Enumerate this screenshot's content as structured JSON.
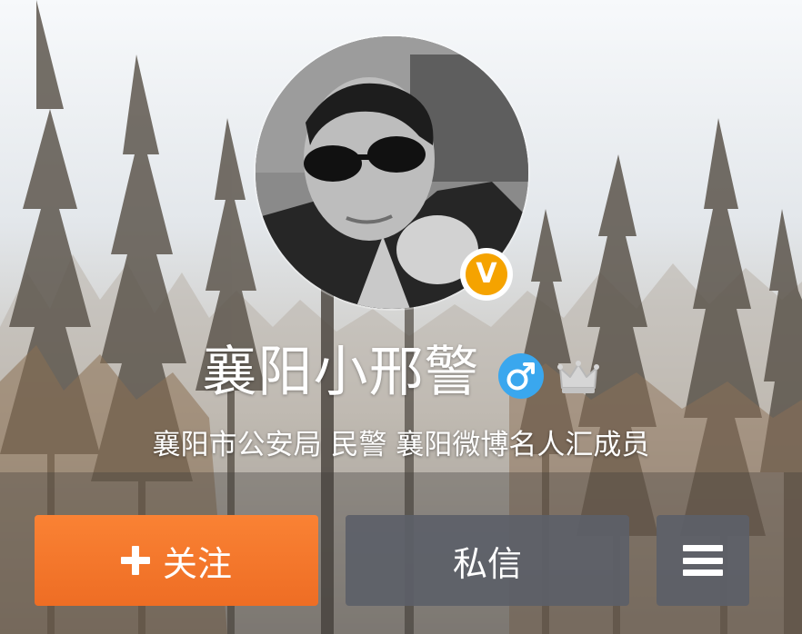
{
  "profile": {
    "name": "襄阳小邢警",
    "verified_badge_letter": "V",
    "gender": "male",
    "gender_icon": "male-symbol-icon",
    "member_icon": "crown-icon",
    "description": "襄阳市公安局 民警 襄阳微博名人汇成员"
  },
  "actions": {
    "follow_label": "关注",
    "follow_icon": "plus-icon",
    "message_label": "私信",
    "menu_icon": "hamburger-menu-icon"
  },
  "colors": {
    "follow_button": "#f0742a",
    "secondary_button": "#5c6068",
    "verified_badge": "#f5a300",
    "gender_icon": "#3aa7ee"
  }
}
